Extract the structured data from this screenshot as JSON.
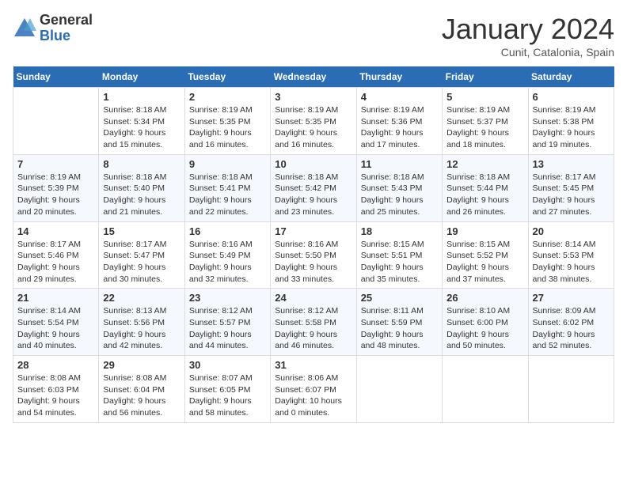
{
  "logo": {
    "general": "General",
    "blue": "Blue"
  },
  "header": {
    "month": "January 2024",
    "location": "Cunit, Catalonia, Spain"
  },
  "days_of_week": [
    "Sunday",
    "Monday",
    "Tuesday",
    "Wednesday",
    "Thursday",
    "Friday",
    "Saturday"
  ],
  "weeks": [
    [
      {
        "day": "",
        "sunrise": "",
        "sunset": "",
        "daylight": ""
      },
      {
        "day": "1",
        "sunrise": "Sunrise: 8:18 AM",
        "sunset": "Sunset: 5:34 PM",
        "daylight": "Daylight: 9 hours and 15 minutes."
      },
      {
        "day": "2",
        "sunrise": "Sunrise: 8:19 AM",
        "sunset": "Sunset: 5:35 PM",
        "daylight": "Daylight: 9 hours and 16 minutes."
      },
      {
        "day": "3",
        "sunrise": "Sunrise: 8:19 AM",
        "sunset": "Sunset: 5:35 PM",
        "daylight": "Daylight: 9 hours and 16 minutes."
      },
      {
        "day": "4",
        "sunrise": "Sunrise: 8:19 AM",
        "sunset": "Sunset: 5:36 PM",
        "daylight": "Daylight: 9 hours and 17 minutes."
      },
      {
        "day": "5",
        "sunrise": "Sunrise: 8:19 AM",
        "sunset": "Sunset: 5:37 PM",
        "daylight": "Daylight: 9 hours and 18 minutes."
      },
      {
        "day": "6",
        "sunrise": "Sunrise: 8:19 AM",
        "sunset": "Sunset: 5:38 PM",
        "daylight": "Daylight: 9 hours and 19 minutes."
      }
    ],
    [
      {
        "day": "7",
        "sunrise": "Sunrise: 8:19 AM",
        "sunset": "Sunset: 5:39 PM",
        "daylight": "Daylight: 9 hours and 20 minutes."
      },
      {
        "day": "8",
        "sunrise": "Sunrise: 8:18 AM",
        "sunset": "Sunset: 5:40 PM",
        "daylight": "Daylight: 9 hours and 21 minutes."
      },
      {
        "day": "9",
        "sunrise": "Sunrise: 8:18 AM",
        "sunset": "Sunset: 5:41 PM",
        "daylight": "Daylight: 9 hours and 22 minutes."
      },
      {
        "day": "10",
        "sunrise": "Sunrise: 8:18 AM",
        "sunset": "Sunset: 5:42 PM",
        "daylight": "Daylight: 9 hours and 23 minutes."
      },
      {
        "day": "11",
        "sunrise": "Sunrise: 8:18 AM",
        "sunset": "Sunset: 5:43 PM",
        "daylight": "Daylight: 9 hours and 25 minutes."
      },
      {
        "day": "12",
        "sunrise": "Sunrise: 8:18 AM",
        "sunset": "Sunset: 5:44 PM",
        "daylight": "Daylight: 9 hours and 26 minutes."
      },
      {
        "day": "13",
        "sunrise": "Sunrise: 8:17 AM",
        "sunset": "Sunset: 5:45 PM",
        "daylight": "Daylight: 9 hours and 27 minutes."
      }
    ],
    [
      {
        "day": "14",
        "sunrise": "Sunrise: 8:17 AM",
        "sunset": "Sunset: 5:46 PM",
        "daylight": "Daylight: 9 hours and 29 minutes."
      },
      {
        "day": "15",
        "sunrise": "Sunrise: 8:17 AM",
        "sunset": "Sunset: 5:47 PM",
        "daylight": "Daylight: 9 hours and 30 minutes."
      },
      {
        "day": "16",
        "sunrise": "Sunrise: 8:16 AM",
        "sunset": "Sunset: 5:49 PM",
        "daylight": "Daylight: 9 hours and 32 minutes."
      },
      {
        "day": "17",
        "sunrise": "Sunrise: 8:16 AM",
        "sunset": "Sunset: 5:50 PM",
        "daylight": "Daylight: 9 hours and 33 minutes."
      },
      {
        "day": "18",
        "sunrise": "Sunrise: 8:15 AM",
        "sunset": "Sunset: 5:51 PM",
        "daylight": "Daylight: 9 hours and 35 minutes."
      },
      {
        "day": "19",
        "sunrise": "Sunrise: 8:15 AM",
        "sunset": "Sunset: 5:52 PM",
        "daylight": "Daylight: 9 hours and 37 minutes."
      },
      {
        "day": "20",
        "sunrise": "Sunrise: 8:14 AM",
        "sunset": "Sunset: 5:53 PM",
        "daylight": "Daylight: 9 hours and 38 minutes."
      }
    ],
    [
      {
        "day": "21",
        "sunrise": "Sunrise: 8:14 AM",
        "sunset": "Sunset: 5:54 PM",
        "daylight": "Daylight: 9 hours and 40 minutes."
      },
      {
        "day": "22",
        "sunrise": "Sunrise: 8:13 AM",
        "sunset": "Sunset: 5:56 PM",
        "daylight": "Daylight: 9 hours and 42 minutes."
      },
      {
        "day": "23",
        "sunrise": "Sunrise: 8:12 AM",
        "sunset": "Sunset: 5:57 PM",
        "daylight": "Daylight: 9 hours and 44 minutes."
      },
      {
        "day": "24",
        "sunrise": "Sunrise: 8:12 AM",
        "sunset": "Sunset: 5:58 PM",
        "daylight": "Daylight: 9 hours and 46 minutes."
      },
      {
        "day": "25",
        "sunrise": "Sunrise: 8:11 AM",
        "sunset": "Sunset: 5:59 PM",
        "daylight": "Daylight: 9 hours and 48 minutes."
      },
      {
        "day": "26",
        "sunrise": "Sunrise: 8:10 AM",
        "sunset": "Sunset: 6:00 PM",
        "daylight": "Daylight: 9 hours and 50 minutes."
      },
      {
        "day": "27",
        "sunrise": "Sunrise: 8:09 AM",
        "sunset": "Sunset: 6:02 PM",
        "daylight": "Daylight: 9 hours and 52 minutes."
      }
    ],
    [
      {
        "day": "28",
        "sunrise": "Sunrise: 8:08 AM",
        "sunset": "Sunset: 6:03 PM",
        "daylight": "Daylight: 9 hours and 54 minutes."
      },
      {
        "day": "29",
        "sunrise": "Sunrise: 8:08 AM",
        "sunset": "Sunset: 6:04 PM",
        "daylight": "Daylight: 9 hours and 56 minutes."
      },
      {
        "day": "30",
        "sunrise": "Sunrise: 8:07 AM",
        "sunset": "Sunset: 6:05 PM",
        "daylight": "Daylight: 9 hours and 58 minutes."
      },
      {
        "day": "31",
        "sunrise": "Sunrise: 8:06 AM",
        "sunset": "Sunset: 6:07 PM",
        "daylight": "Daylight: 10 hours and 0 minutes."
      },
      {
        "day": "",
        "sunrise": "",
        "sunset": "",
        "daylight": ""
      },
      {
        "day": "",
        "sunrise": "",
        "sunset": "",
        "daylight": ""
      },
      {
        "day": "",
        "sunrise": "",
        "sunset": "",
        "daylight": ""
      }
    ]
  ]
}
